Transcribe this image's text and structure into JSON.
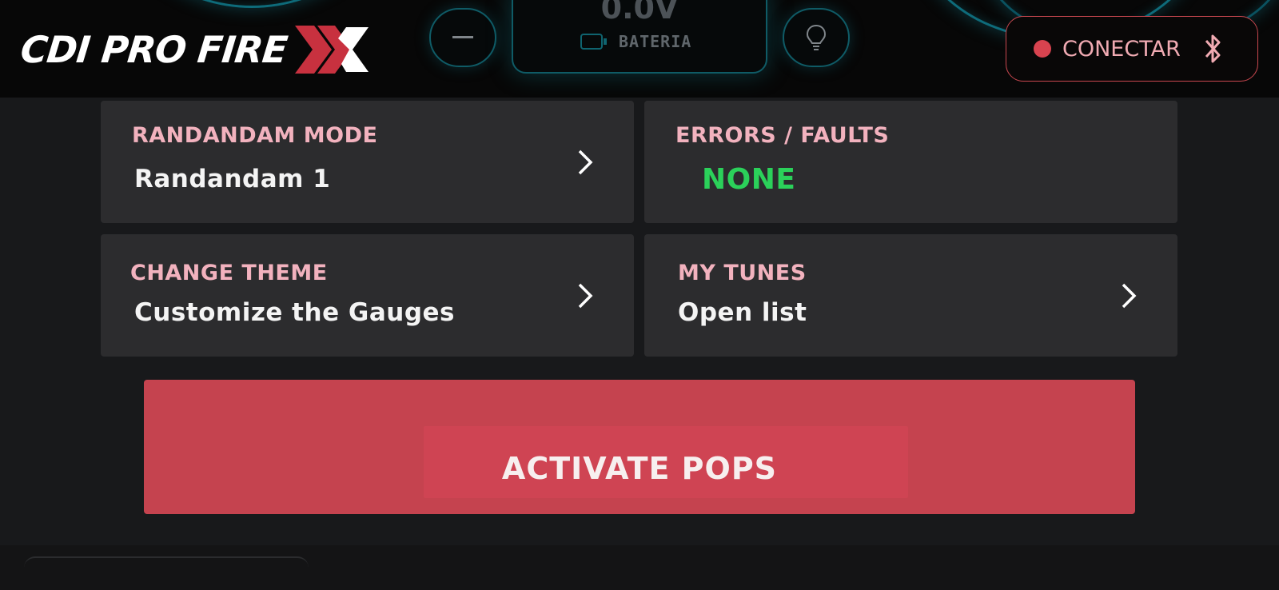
{
  "header": {
    "logo_text": "CDI PRO FIRE",
    "battery": {
      "value": "0.0V",
      "label": "BATERIA"
    },
    "connect": {
      "label": "CONECTAR"
    },
    "colors": {
      "brand_red": "#d8434f",
      "accent_teal": "#0f5b66"
    }
  },
  "cards": {
    "randandam": {
      "title": "RANDANDAM MODE",
      "value": "Randandam 1"
    },
    "errors": {
      "title": "ERRORS / FAULTS",
      "value": "NONE"
    },
    "theme": {
      "title": "CHANGE THEME",
      "value": "Customize the Gauges"
    },
    "tunes": {
      "title": "MY TUNES",
      "value": "Open list"
    }
  },
  "activate": {
    "label": "ACTIVATE POPS"
  }
}
